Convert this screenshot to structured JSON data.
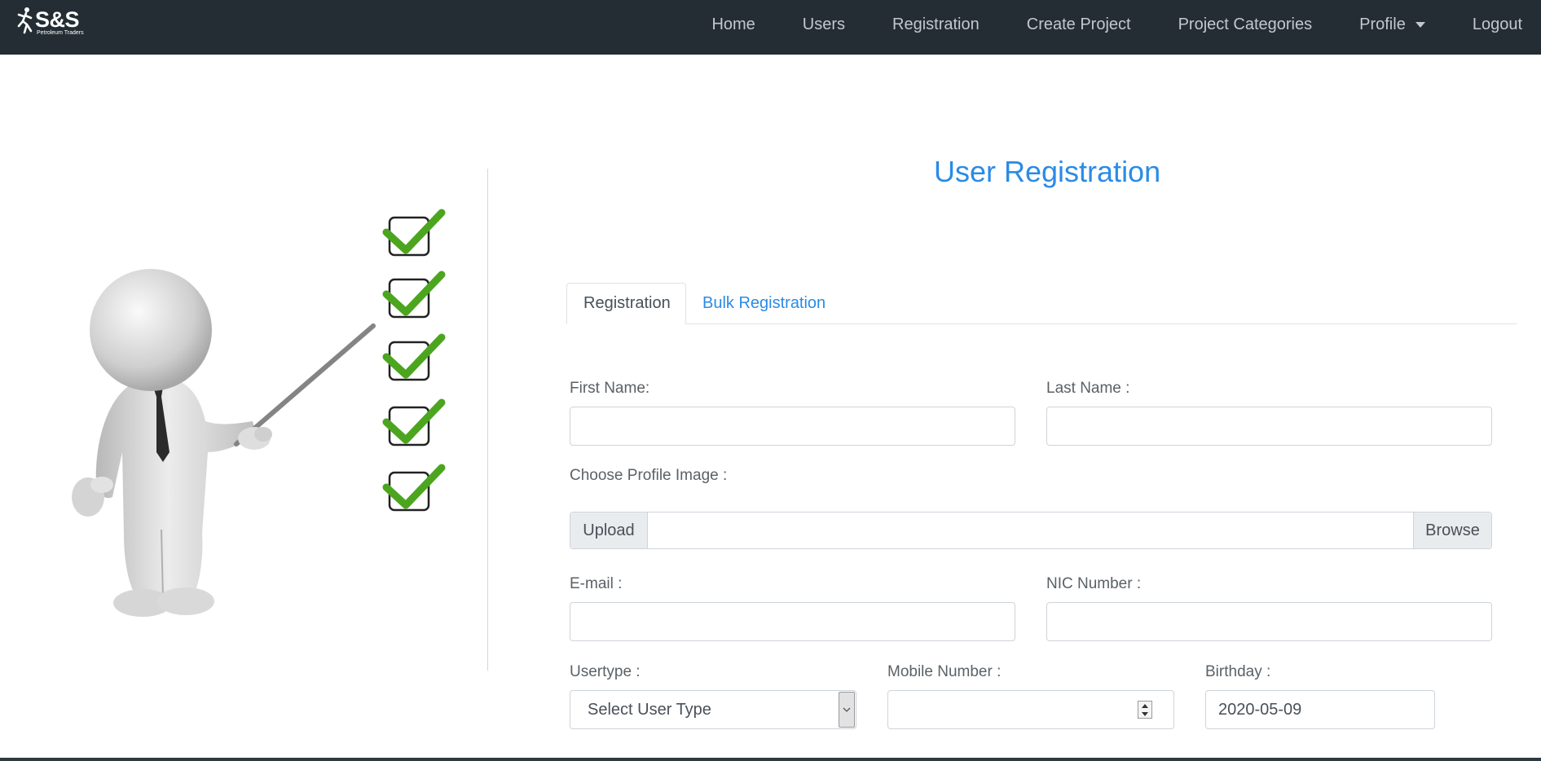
{
  "brand": {
    "name": "S&S",
    "subtitle": "Petroleum Traders"
  },
  "nav": {
    "items": [
      "Home",
      "Users",
      "Registration",
      "Create Project",
      "Project Categories",
      "Profile",
      "Logout"
    ]
  },
  "page": {
    "title": "User Registration"
  },
  "tabs": [
    {
      "label": "Registration",
      "active": true
    },
    {
      "label": "Bulk Registration",
      "active": false
    }
  ],
  "form": {
    "first_name": {
      "label": "First Name:",
      "value": ""
    },
    "last_name": {
      "label": "Last Name :",
      "value": ""
    },
    "profile_image": {
      "label": "Choose Profile Image :",
      "prepend": "Upload",
      "browse": "Browse"
    },
    "email": {
      "label": "E-mail :",
      "value": ""
    },
    "nic": {
      "label": "NIC Number :",
      "value": ""
    },
    "usertype": {
      "label": "Usertype :",
      "selected": "Select User Type"
    },
    "mobile": {
      "label": "Mobile Number :",
      "value": ""
    },
    "birthday": {
      "label": "Birthday :",
      "value": "2020-05-09"
    }
  },
  "colors": {
    "navbar": "#232d33",
    "accent": "#2a8be6",
    "check": "#4ca51f"
  }
}
